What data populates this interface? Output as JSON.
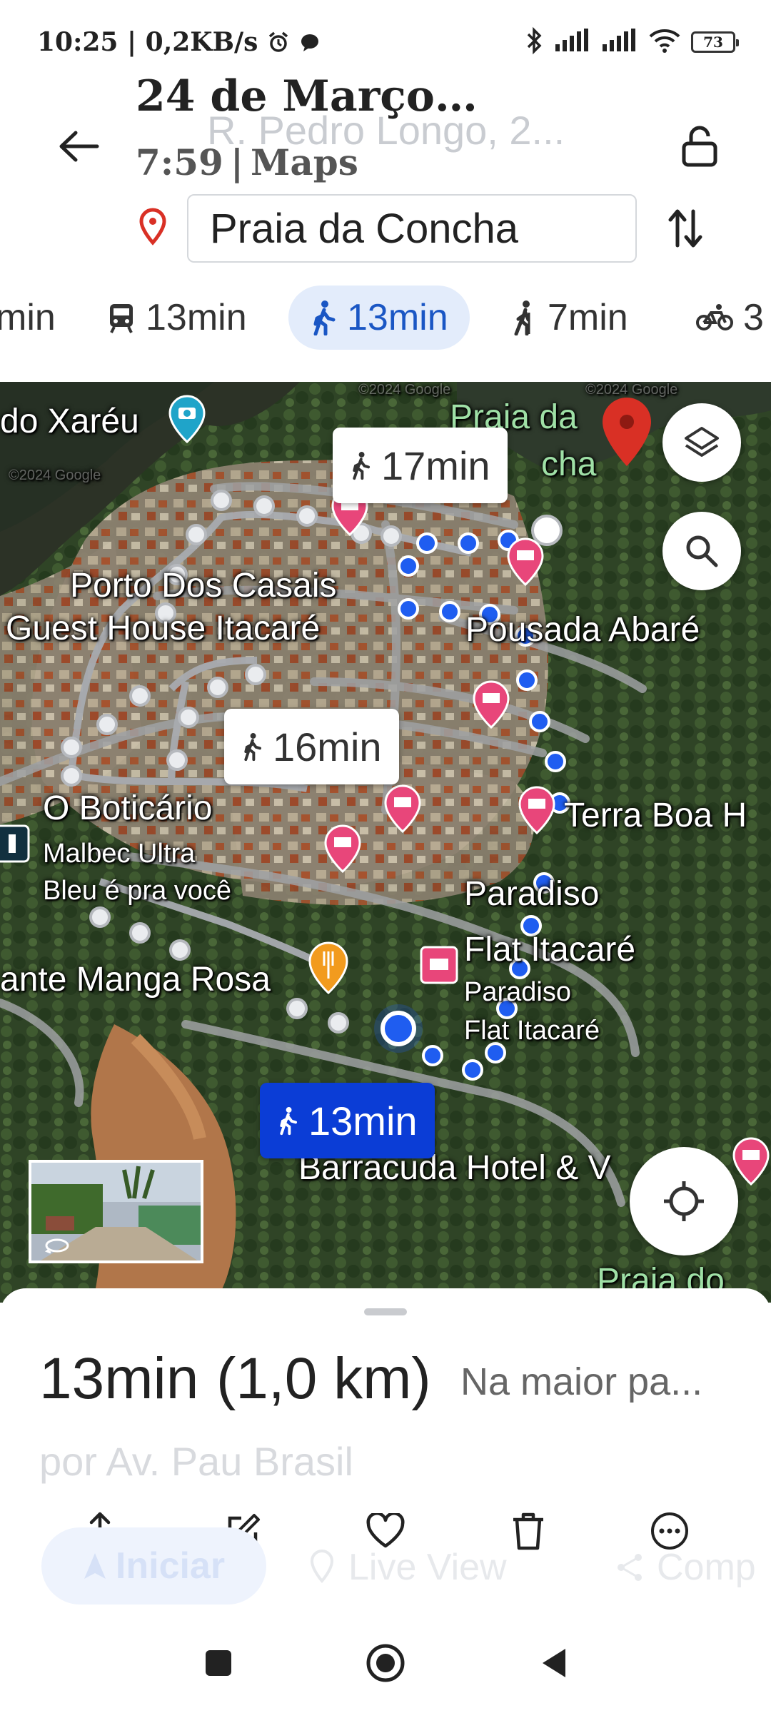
{
  "status_bar": {
    "time_net": "10:25 | 0,2KB/s",
    "battery": "73"
  },
  "header": {
    "title": "24 de Março…",
    "subtitle": "7:59 | Maps",
    "origin_faded": "R. Pedro Longo, 2...",
    "destination": "Praia da Concha"
  },
  "modes": [
    {
      "label": "min",
      "icon": "car-icon"
    },
    {
      "label": "13min",
      "icon": "transit-icon"
    },
    {
      "label": "13min",
      "icon": "walk-icon",
      "active": true
    },
    {
      "label": "7min",
      "icon": "ride-icon"
    },
    {
      "label": "3",
      "icon": "bike-icon"
    }
  ],
  "map": {
    "labels": {
      "xareu": "do Xaréu",
      "praia_da": "Praia da",
      "concha_frag": "cha",
      "porto": "Porto Dos Casais",
      "guesthouse": "Guest House Itacaré",
      "pousada": "Pousada Abaré",
      "boticario": "O Boticário",
      "malbec": "Malbec Ultra",
      "bleu": "Bleu é pra você",
      "terra": "Terra Boa H",
      "paradiso": "Paradiso",
      "flat": "Flat Itacaré",
      "paradiso2": "Paradiso",
      "flat2": "Flat Itacaré",
      "manga": "ante Manga Rosa",
      "barracuda": "Barracuda Hotel & V",
      "praia_do": "Praia do",
      "copyright1": "©2024 Google",
      "copyright2": "©2024 Google",
      "copyright3": "©2024 Google"
    },
    "callouts": {
      "alt1": "17min",
      "alt2": "16min",
      "primary": "13min"
    }
  },
  "summary": {
    "time": "13min",
    "distance": "(1,0 km)",
    "description": "Na maior pa...",
    "via": "por Av. Pau Brasil"
  },
  "bottom_faded": {
    "start": "Iniciar",
    "live_view": "Live View",
    "share": "Comp"
  },
  "colors": {
    "accent": "#1a56c4",
    "route_blue": "#1f5df0",
    "alt_route": "#b9bcc2",
    "primary_callout": "#0b3dd6"
  }
}
